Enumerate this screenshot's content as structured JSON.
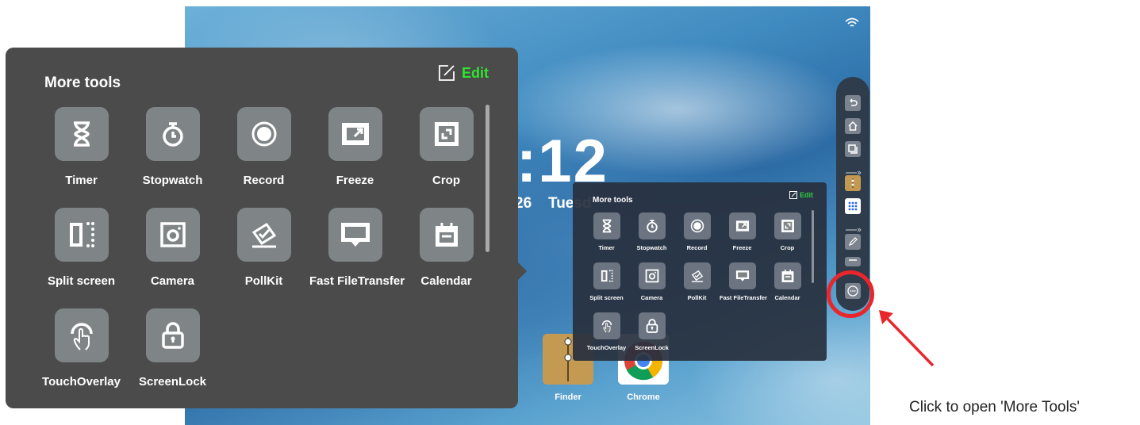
{
  "panel": {
    "title": "More tools",
    "edit_label": "Edit",
    "tools": [
      {
        "label": "Timer",
        "icon": "hourglass-icon"
      },
      {
        "label": "Stopwatch",
        "icon": "stopwatch-icon"
      },
      {
        "label": "Record",
        "icon": "record-icon"
      },
      {
        "label": "Freeze",
        "icon": "freeze-icon"
      },
      {
        "label": "Crop",
        "icon": "crop-icon"
      },
      {
        "label": "Split screen",
        "icon": "split-screen-icon"
      },
      {
        "label": "Camera",
        "icon": "camera-icon"
      },
      {
        "label": "PollKit",
        "icon": "pollkit-icon"
      },
      {
        "label": "Fast FileTransfer",
        "icon": "file-transfer-icon"
      },
      {
        "label": "Calendar",
        "icon": "calendar-icon"
      },
      {
        "label": "TouchOverlay",
        "icon": "touch-icon"
      },
      {
        "label": "ScreenLock",
        "icon": "lock-icon"
      }
    ]
  },
  "mini_panel": {
    "title": "More tools",
    "edit_label": "Edit",
    "tools": [
      "Timer",
      "Stopwatch",
      "Record",
      "Freeze",
      "Crop",
      "Split screen",
      "Camera",
      "PollKit",
      "Fast FileTransfer",
      "Calendar",
      "TouchOverlay",
      "ScreenLock"
    ]
  },
  "desktop": {
    "clock": ":12",
    "date_day": "26",
    "date_weekday": "Tuesd",
    "apps": [
      {
        "label": "Finder",
        "icon": "finder-icon"
      },
      {
        "label": "Chrome",
        "icon": "chrome-icon"
      }
    ]
  },
  "dock": {
    "buttons": [
      "back-icon",
      "home-icon",
      "windows-icon",
      "finder-icon",
      "apps-grid-icon",
      "pen-icon",
      "settings-icon",
      "more-icon"
    ]
  },
  "caption": "Click to open 'More Tools'",
  "colors": {
    "edit_green": "#2ee52e",
    "highlight_red": "#e8262b",
    "panel_bg": "#4b4b4b"
  }
}
